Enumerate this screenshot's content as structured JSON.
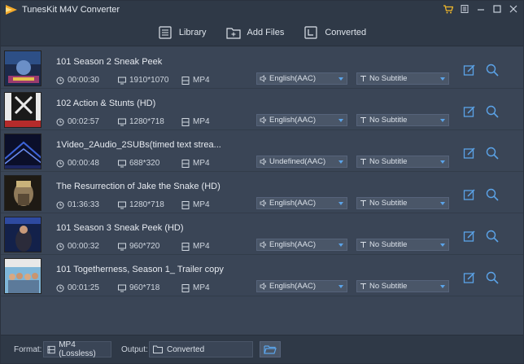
{
  "app": {
    "title": "TunesKit M4V Converter"
  },
  "toolbar": {
    "library_label": "Library",
    "add_files_label": "Add Files",
    "converted_label": "Converted"
  },
  "colors": {
    "accent": "#5ba3e8",
    "cart": "#f0b92b"
  },
  "items": [
    {
      "title": "101 Season 2 Sneak Peek",
      "duration": "00:00:30",
      "resolution": "1910*1070",
      "format": "MP4",
      "audio": "English(AAC)",
      "subtitle": "No Subtitle"
    },
    {
      "title": "102 Action & Stunts (HD)",
      "duration": "00:02:57",
      "resolution": "1280*718",
      "format": "MP4",
      "audio": "English(AAC)",
      "subtitle": "No Subtitle"
    },
    {
      "title": "1Video_2Audio_2SUBs(timed text strea...",
      "duration": "00:00:48",
      "resolution": "688*320",
      "format": "MP4",
      "audio": "Undefined(AAC)",
      "subtitle": "No Subtitle"
    },
    {
      "title": "The Resurrection of Jake the Snake (HD)",
      "duration": "01:36:33",
      "resolution": "1280*718",
      "format": "MP4",
      "audio": "English(AAC)",
      "subtitle": "No Subtitle"
    },
    {
      "title": "101 Season 3 Sneak Peek (HD)",
      "duration": "00:00:32",
      "resolution": "960*720",
      "format": "MP4",
      "audio": "English(AAC)",
      "subtitle": "No Subtitle"
    },
    {
      "title": "101 Togetherness, Season 1_ Trailer copy",
      "duration": "00:01:25",
      "resolution": "960*718",
      "format": "MP4",
      "audio": "English(AAC)",
      "subtitle": "No Subtitle"
    }
  ],
  "footer": {
    "format_label": "Format:",
    "format_value": "MP4 (Lossless)",
    "output_label": "Output:",
    "output_value": "Converted"
  }
}
